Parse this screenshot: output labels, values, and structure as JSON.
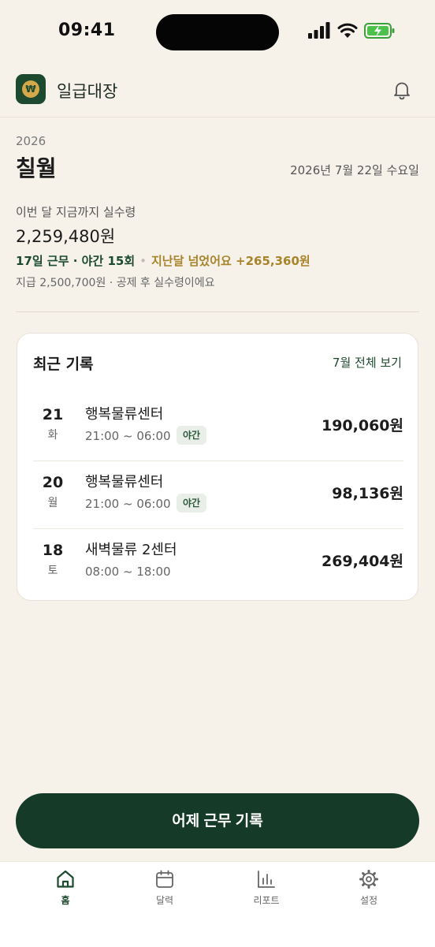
{
  "status_bar": {
    "time": "09:41"
  },
  "header": {
    "app_name": "일급대장",
    "logo_symbol": "₩",
    "bell_icon": "bell-icon"
  },
  "summary": {
    "year": "2026",
    "month": "칠월",
    "today_date": "2026년 7월 22일 수요일",
    "net_label": "이번 달 지금까지 실수령",
    "net_amount": "2,259,480원",
    "work_count": "17일 근무 · 야간 15회",
    "separator": "•",
    "compare_text": "지난달 넘었어요 +265,360원",
    "note": "지급 2,500,700원 · 공제 후 실수령이에요"
  },
  "records": {
    "title": "최근 기록",
    "view_all": "7월 전체 보기",
    "items": [
      {
        "day": "21",
        "weekday": "화",
        "place": "행복물류센터",
        "time": "21:00 ~ 06:00",
        "tag": "야간",
        "amount": "190,060원"
      },
      {
        "day": "20",
        "weekday": "월",
        "place": "행복물류센터",
        "time": "21:00 ~ 06:00",
        "tag": "야간",
        "amount": "98,136원"
      },
      {
        "day": "18",
        "weekday": "토",
        "place": "새벽물류 2센터",
        "time": "08:00 ~ 18:00",
        "tag": "",
        "amount": "269,404원"
      }
    ]
  },
  "cta": {
    "label": "어제 근무 기록"
  },
  "tabs": [
    {
      "label": "홈",
      "icon": "home-icon",
      "active": true
    },
    {
      "label": "달력",
      "icon": "calendar-icon",
      "active": false
    },
    {
      "label": "리포트",
      "icon": "report-icon",
      "active": false
    },
    {
      "label": "설정",
      "icon": "gear-icon",
      "active": false
    }
  ],
  "colors": {
    "brand": "#163a28",
    "accent_gold": "#a8832a",
    "background": "#f6f2ea"
  }
}
